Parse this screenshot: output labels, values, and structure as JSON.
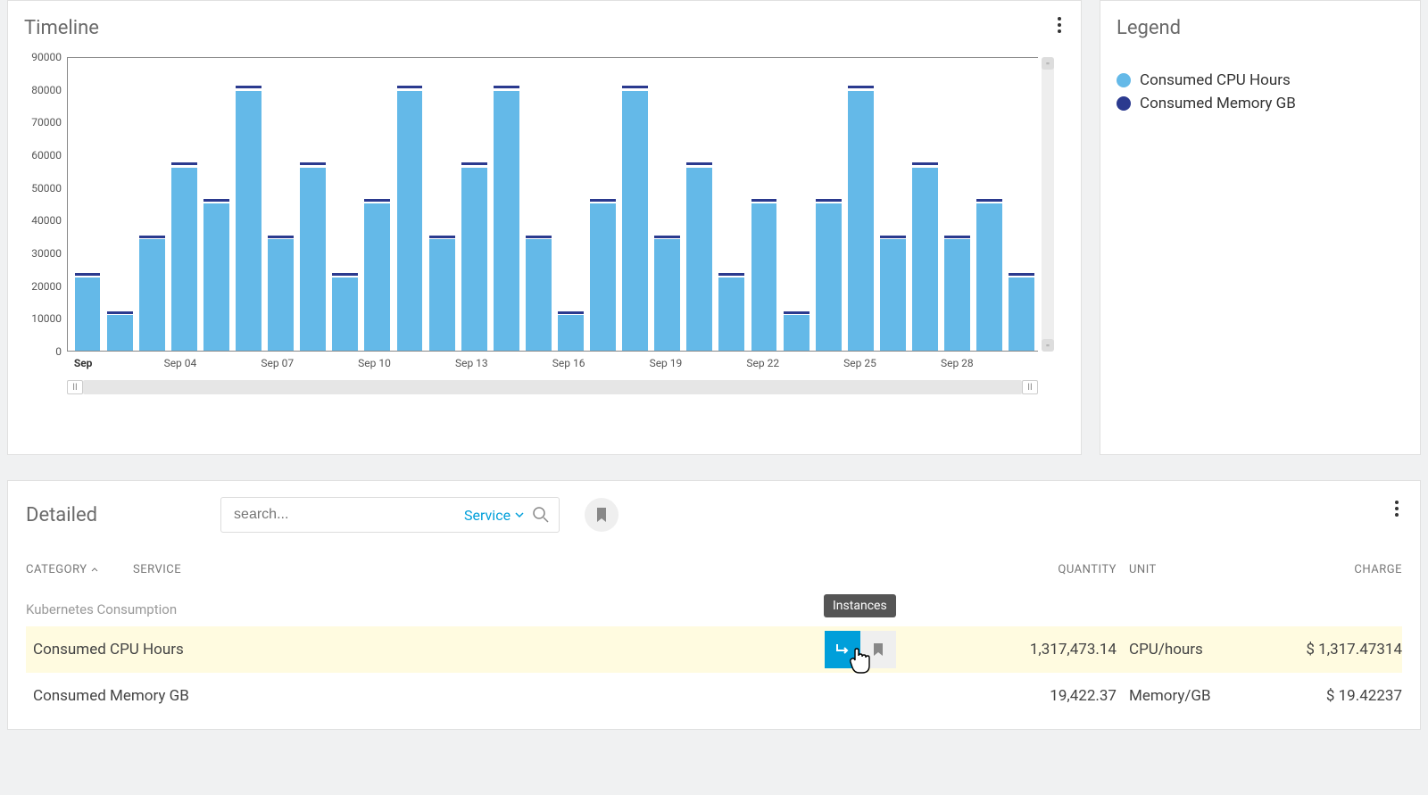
{
  "timeline": {
    "title": "Timeline"
  },
  "legend": {
    "title": "Legend",
    "items": [
      {
        "label": "Consumed CPU Hours",
        "color": "#64b9e8"
      },
      {
        "label": "Consumed Memory GB",
        "color": "#2b3a8f"
      }
    ]
  },
  "chart_data": {
    "type": "bar",
    "ylabel": "",
    "xlabel": "",
    "ylim": [
      0,
      90000
    ],
    "yticks": [
      0,
      10000,
      20000,
      30000,
      40000,
      50000,
      60000,
      70000,
      80000,
      90000
    ],
    "categories": [
      "Sep 01",
      "Sep 02",
      "Sep 03",
      "Sep 04",
      "Sep 05",
      "Sep 06",
      "Sep 07",
      "Sep 08",
      "Sep 09",
      "Sep 10",
      "Sep 11",
      "Sep 12",
      "Sep 13",
      "Sep 14",
      "Sep 15",
      "Sep 16",
      "Sep 17",
      "Sep 18",
      "Sep 19",
      "Sep 20",
      "Sep 21",
      "Sep 22",
      "Sep 23",
      "Sep 24",
      "Sep 25",
      "Sep 26",
      "Sep 27",
      "Sep 28",
      "Sep 29",
      "Sep 30"
    ],
    "x_tick_labels": [
      "Sep",
      "",
      "",
      "Sep 04",
      "",
      "",
      "Sep 07",
      "",
      "",
      "Sep 10",
      "",
      "",
      "Sep 13",
      "",
      "",
      "Sep 16",
      "",
      "",
      "Sep 19",
      "",
      "",
      "Sep 22",
      "",
      "",
      "Sep 25",
      "",
      "",
      "Sep 28",
      "",
      ""
    ],
    "series": [
      {
        "name": "Consumed CPU Hours",
        "color": "#64b9e8",
        "values": [
          22500,
          11000,
          34000,
          56000,
          45000,
          79500,
          34000,
          56000,
          22500,
          45000,
          79500,
          34000,
          56000,
          79500,
          34000,
          11000,
          45000,
          79500,
          34000,
          56000,
          22500,
          45000,
          11000,
          45000,
          79500,
          34000,
          56000,
          34000,
          45000,
          22500
        ]
      },
      {
        "name": "Consumed Memory GB",
        "color": "#2b3a8f",
        "values": [
          22800,
          11200,
          34400,
          56800,
          45500,
          80300,
          34400,
          56800,
          22800,
          45500,
          80300,
          34400,
          56800,
          80300,
          34400,
          11200,
          45500,
          80300,
          34400,
          56800,
          22800,
          45500,
          11200,
          45500,
          80300,
          34400,
          56800,
          34400,
          45500,
          22800
        ]
      }
    ]
  },
  "detailed": {
    "title": "Detailed",
    "search_placeholder": "search...",
    "filter_label": "Service",
    "headers": {
      "category": "CATEGORY",
      "service": "SERVICE",
      "quantity": "QUANTITY",
      "unit": "UNIT",
      "charge": "CHARGE"
    },
    "group": "Kubernetes Consumption",
    "rows": [
      {
        "name": "Consumed CPU Hours",
        "quantity": "1,317,473.14",
        "unit": "CPU/hours",
        "charge": "$ 1,317.47314"
      },
      {
        "name": "Consumed Memory GB",
        "quantity": "19,422.37",
        "unit": "Memory/GB",
        "charge": "$ 19.42237"
      }
    ],
    "tooltip": "Instances"
  }
}
